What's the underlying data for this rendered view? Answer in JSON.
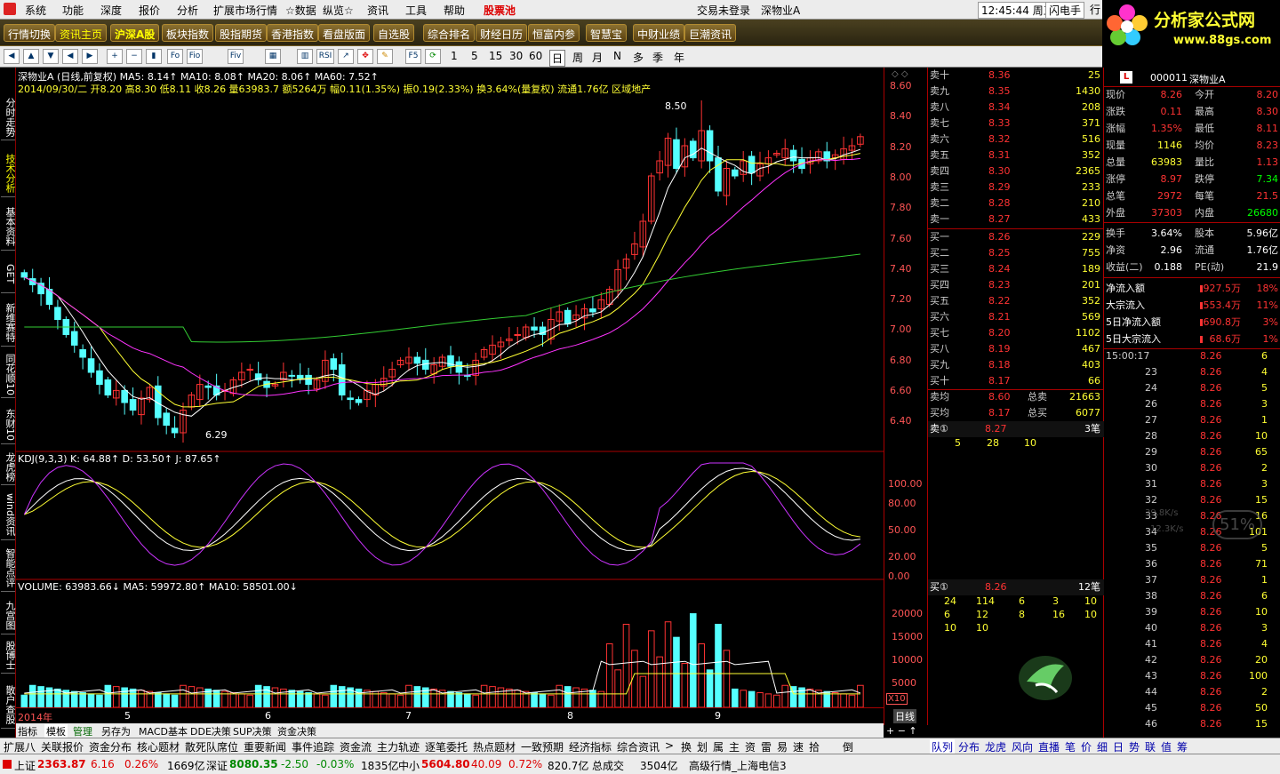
{
  "menu": [
    "系统",
    "功能",
    "深度",
    "报价",
    "分析",
    "扩展市场行情",
    "☆数据",
    "纵览☆",
    "资讯",
    "工具",
    "帮助",
    "股票池"
  ],
  "title_status": "交易未登录",
  "title_stock": "深物业A",
  "clock": "12:45:44 周五",
  "flash": "闪电手",
  "row": "行",
  "logo": {
    "brand": "分析家公式网",
    "url": "www.88gs.com"
  },
  "tabs": [
    "行情切换",
    "资讯主页",
    "沪深A股",
    "板块指数",
    "股指期货",
    "香港指数",
    "看盘版面",
    "自选股",
    "综合排名",
    "财经日历",
    "恒富内参",
    "智慧宝",
    "中财业绩",
    "巨潮资讯"
  ],
  "icons": [
    "Fo",
    "Fio",
    "Fiv",
    "RSI"
  ],
  "periods": [
    "1",
    "5",
    "15",
    "30",
    "60",
    "日",
    "周",
    "月",
    "N",
    "多",
    "季",
    "年"
  ],
  "vtabs": [
    "分时走势",
    "技术分析",
    "基本资料",
    "GET",
    "新维赛特",
    "同花顺10",
    "东财10",
    "龙虎榜",
    "wind资讯",
    "智能点评",
    "九宫图",
    "股博士",
    "散户查股"
  ],
  "chart": {
    "line1": "深物业A (日线,前复权) MA5: 8.14↑ MA10: 8.08↑ MA20: 8.06↑ MA60: 7.52↑",
    "line2": "2014/09/30/二 开8.20 高8.30 低8.11 收8.26 量63983.7 额5264万 幅0.11(1.35%) 振0.19(2.33%) 换3.64%(量复权) 流通1.76亿 区域地产",
    "high_label": "8.50",
    "low_label": "6.29",
    "kdj_title": "KDJ(9,3,3) K: 64.88↑ D: 53.50↑ J: 87.65↑",
    "vol_title": "VOLUME: 63983.66↓ MA5: 59972.80↑ MA10: 58501.00↓",
    "price_axis": [
      "8.60",
      "8.40",
      "8.20",
      "8.00",
      "7.80",
      "7.60",
      "7.40",
      "7.20",
      "7.00",
      "6.80",
      "6.60",
      "6.40"
    ],
    "kdj_axis": [
      "100.00",
      "80.00",
      "50.00",
      "20.00",
      "0.00"
    ],
    "vol_axis": [
      "20000",
      "15000",
      "10000",
      "5000"
    ],
    "x_labels": [
      "2014年",
      "5",
      "6",
      "7",
      "8",
      "9"
    ],
    "vol_scale": "X10",
    "period_name": "日线"
  },
  "chart_data": {
    "type": "candlestick",
    "closes": [
      7.33,
      7.28,
      7.22,
      7.15,
      7.05,
      6.95,
      6.88,
      6.8,
      6.7,
      6.62,
      6.55,
      6.58,
      6.5,
      6.45,
      6.53,
      6.6,
      6.4,
      6.35,
      6.3,
      6.45,
      6.55,
      6.62,
      6.6,
      6.55,
      6.58,
      6.65,
      6.7,
      6.72,
      6.65,
      6.6,
      6.62,
      6.7,
      6.68,
      6.66,
      6.62,
      6.65,
      6.78,
      6.72,
      6.55,
      6.52,
      6.5,
      6.58,
      6.62,
      6.66,
      6.72,
      6.78,
      6.8,
      6.76,
      6.72,
      6.75,
      6.8,
      6.74,
      6.7,
      6.68,
      6.78,
      6.85,
      6.88,
      6.9,
      6.92,
      6.95,
      7.0,
      6.98,
      6.95,
      7.05,
      7.1,
      7.02,
      7.08,
      7.12,
      7.1,
      7.18,
      7.25,
      7.38,
      7.45,
      7.55,
      7.7,
      8.0,
      8.1,
      8.25,
      8.05,
      8.2,
      8.12,
      8.3,
      8.1,
      7.9,
      8.05,
      8.0,
      8.1,
      8.02,
      8.08,
      8.12,
      8.15,
      8.18,
      8.1,
      8.05,
      8.12,
      8.16,
      8.1,
      8.14,
      8.18,
      8.2,
      8.26
    ]
  },
  "bottom_tabs": [
    "指标",
    "模板",
    "管理",
    "另存为",
    "MACD基本",
    "DDE决策",
    "SUP决策",
    "资金决策"
  ],
  "bottom_tools": [
    "扩展八",
    "关联报价",
    "资金分布",
    "核心题材",
    "散死队席位",
    "重要新闻",
    "事件追踪",
    "资金流",
    "主力轨迹",
    "逐笔委托",
    "热点题材",
    "一致预期",
    "经济指标",
    "综合资讯",
    ">",
    "换",
    "划",
    "属",
    "主",
    "资",
    "雷",
    "易",
    "速",
    "拾",
    "倒",
    "队列",
    "分布",
    "龙虎",
    "风向",
    "直播",
    "笔",
    "价",
    "细",
    "日",
    "势",
    "联",
    "值",
    "筹"
  ],
  "quote": {
    "sell": [
      [
        "卖十",
        "8.36",
        "25"
      ],
      [
        "卖九",
        "8.35",
        "1430"
      ],
      [
        "卖八",
        "8.34",
        "208"
      ],
      [
        "卖七",
        "8.33",
        "371"
      ],
      [
        "卖六",
        "8.32",
        "516"
      ],
      [
        "卖五",
        "8.31",
        "352"
      ],
      [
        "卖四",
        "8.30",
        "2365"
      ],
      [
        "卖三",
        "8.29",
        "233"
      ],
      [
        "卖二",
        "8.28",
        "210"
      ],
      [
        "卖一",
        "8.27",
        "433"
      ]
    ],
    "buy": [
      [
        "买一",
        "8.26",
        "229"
      ],
      [
        "买二",
        "8.25",
        "755"
      ],
      [
        "买三",
        "8.24",
        "189"
      ],
      [
        "买四",
        "8.23",
        "201"
      ],
      [
        "买五",
        "8.22",
        "352"
      ],
      [
        "买六",
        "8.21",
        "569"
      ],
      [
        "买七",
        "8.20",
        "1102"
      ],
      [
        "买八",
        "8.19",
        "467"
      ],
      [
        "买九",
        "8.18",
        "403"
      ],
      [
        "买十",
        "8.17",
        "66"
      ]
    ],
    "avg": [
      [
        "卖均",
        "8.60",
        "总卖",
        "21663"
      ],
      [
        "买均",
        "8.17",
        "总买",
        "6077"
      ]
    ],
    "s1": [
      "卖①",
      "8.27",
      "3笔"
    ],
    "s1q": [
      "5",
      "28",
      "10"
    ],
    "b1": [
      "买①",
      "8.26",
      "12笔"
    ],
    "b1q": [
      [
        "24",
        "114",
        "6",
        "3",
        "10"
      ],
      [
        "6",
        "12",
        "8",
        "16",
        "10"
      ],
      [
        "10",
        "10"
      ]
    ]
  },
  "info": {
    "code": "000011",
    "name": "深物业A",
    "rows": [
      [
        "现价",
        "8.26",
        "今开",
        "8.20"
      ],
      [
        "涨跌",
        "0.11",
        "最高",
        "8.30"
      ],
      [
        "涨幅",
        "1.35%",
        "最低",
        "8.11"
      ],
      [
        "现量",
        "1146",
        "均价",
        "8.23"
      ],
      [
        "总量",
        "63983",
        "量比",
        "1.13"
      ],
      [
        "涨停",
        "8.97",
        "跌停",
        "7.34"
      ],
      [
        "总笔",
        "2972",
        "每笔",
        "21.5"
      ],
      [
        "外盘",
        "37303",
        "内盘",
        "26680"
      ],
      [
        "换手",
        "3.64%",
        "股本",
        "5.96亿"
      ],
      [
        "净资",
        "2.96",
        "流通",
        "1.76亿"
      ],
      [
        "收益(二)",
        "0.188",
        "PE(动)",
        "21.9"
      ]
    ],
    "flow": [
      [
        "净流入额",
        "927.5万",
        "18%"
      ],
      [
        "大宗流入",
        "553.4万",
        "11%"
      ],
      [
        "5日净流入额",
        "690.8万",
        "3%"
      ],
      [
        "5日大宗流入",
        "68.6万",
        "1%"
      ]
    ],
    "ticks": [
      [
        "15:00:17",
        "8.26",
        "6"
      ],
      [
        "23",
        "8.26",
        "4"
      ],
      [
        "24",
        "8.26",
        "5"
      ],
      [
        "26",
        "8.26",
        "3"
      ],
      [
        "27",
        "8.26",
        "1"
      ],
      [
        "28",
        "8.26",
        "10"
      ],
      [
        "29",
        "8.26",
        "65"
      ],
      [
        "30",
        "8.26",
        "2"
      ],
      [
        "31",
        "8.26",
        "3"
      ],
      [
        "32",
        "8.26",
        "15"
      ],
      [
        "33",
        "8.26",
        "16"
      ],
      [
        "34",
        "8.26",
        "101"
      ],
      [
        "35",
        "8.26",
        "5"
      ],
      [
        "36",
        "8.26",
        "71"
      ],
      [
        "37",
        "8.26",
        "1"
      ],
      [
        "38",
        "8.26",
        "6"
      ],
      [
        "39",
        "8.26",
        "10"
      ],
      [
        "40",
        "8.26",
        "3"
      ],
      [
        "41",
        "8.26",
        "4"
      ],
      [
        "42",
        "8.26",
        "20"
      ],
      [
        "43",
        "8.26",
        "100"
      ],
      [
        "44",
        "8.26",
        "2"
      ],
      [
        "45",
        "8.26",
        "50"
      ],
      [
        "46",
        "8.26",
        "15"
      ]
    ],
    "gauge": [
      "39.8K/s",
      "12.3K/s",
      "51%"
    ]
  },
  "status": {
    "sh": [
      "上证",
      "2363.87",
      "6.16",
      "0.26%",
      "1669亿"
    ],
    "sz": [
      "深证",
      "8080.35",
      "-2.50",
      "-0.03%",
      "1835亿"
    ],
    "zx": [
      "中小",
      "5604.80",
      "40.09",
      "0.72%",
      "820.7亿"
    ],
    "deal": "总成交",
    "amount": "3504亿",
    "feed": "高级行情_上海电信3"
  }
}
